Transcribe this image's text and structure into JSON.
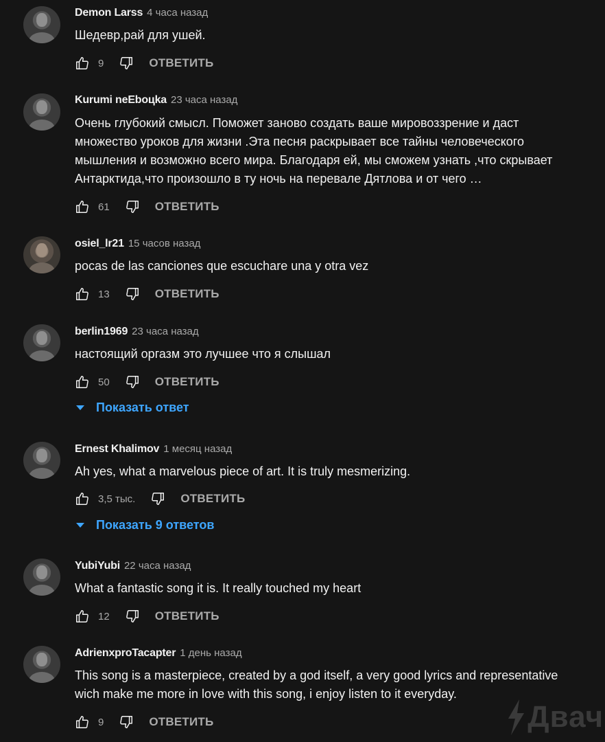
{
  "comments": [
    {
      "author": "Demon Larss",
      "time": "4 часа назад",
      "text": "Шедевр,рай для ушей.",
      "likes": "9",
      "reply_label": "ОТВЕТИТЬ"
    },
    {
      "author": "Kurumi neEboцka",
      "time": "23 часа назад",
      "text": "Очень глубокий смысл. Поможет заново создать ваше мировоззрение и даст множество уроков для жизни .Эта песня раскрывает все тайны человеческого мышления и возможно всего мира. Благодаря ей, мы сможем узнать ,что скрывает Антарктида,что произошло в ту ночь на перевале Дятлова и от чего …",
      "likes": "61",
      "reply_label": "ОТВЕТИТЬ"
    },
    {
      "author": "osiel_lr21",
      "time": "15 часов назад",
      "text": "pocas de las canciones que escuchare una y otra vez",
      "likes": "13",
      "reply_label": "ОТВЕТИТЬ"
    },
    {
      "author": "berlin1969",
      "time": "23 часа назад",
      "text": "настоящий оргазм это лучшее что я слышал",
      "likes": "50",
      "reply_label": "ОТВЕТИТЬ",
      "replies_label": "Показать ответ"
    },
    {
      "author": "Ernest Khalimov",
      "time": "1 месяц назад",
      "text": "Ah yes, what a marvelous piece of art. It is truly mesmerizing.",
      "likes": "3,5 тыс.",
      "reply_label": "ОТВЕТИТЬ",
      "replies_label": "Показать 9 ответов"
    },
    {
      "author": "YubiYubi",
      "time": "22 часа назад",
      "text": "What a fantastic song it is. It really touched my heart",
      "likes": "12",
      "reply_label": "ОТВЕТИТЬ"
    },
    {
      "author": "AdrienxproTacapter",
      "time": "1 день назад",
      "text": "This song is a masterpiece, created by a god itself, a very good lyrics and representative wich make me more in love with this song, i enjoy listen to it everyday.",
      "likes": "9",
      "reply_label": "ОТВЕТИТЬ"
    }
  ],
  "watermark": {
    "text": "Двач"
  },
  "colors": {
    "background": "#151515",
    "text": "#f1f1f1",
    "secondary": "#aaaaaa",
    "link": "#3ea6ff"
  }
}
